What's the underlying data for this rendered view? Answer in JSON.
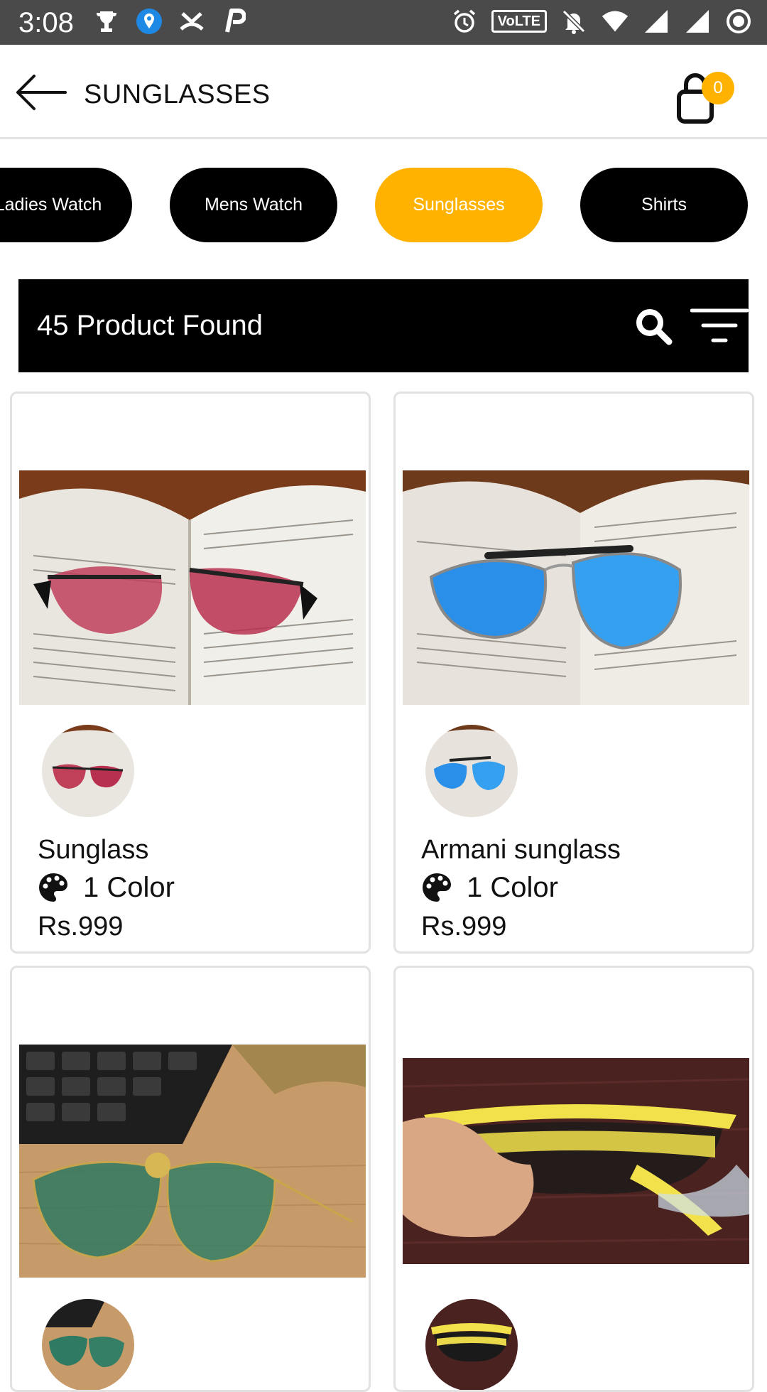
{
  "status_bar": {
    "time": "3:08",
    "volte": "VoLTE"
  },
  "header": {
    "title": "SUNGLASSES",
    "cart_count": "0"
  },
  "categories": [
    {
      "label": "Ladies Watch"
    },
    {
      "label": "Mens Watch"
    },
    {
      "label": "Sunglasses"
    },
    {
      "label": "Shirts"
    }
  ],
  "active_category": "Sunglasses",
  "results": {
    "text": "45 Product Found"
  },
  "products": [
    {
      "name": "Sunglass",
      "colors": "1 Color",
      "price": "Rs.999"
    },
    {
      "name": "Armani sunglass",
      "colors": "1 Color",
      "price": "Rs.999"
    },
    {
      "name": "",
      "colors": "",
      "price": ""
    },
    {
      "name": "",
      "colors": "",
      "price": ""
    }
  ],
  "colors": {
    "accent": "#ffb300",
    "chip": "#000000",
    "statusbar": "#4a4a4a"
  }
}
